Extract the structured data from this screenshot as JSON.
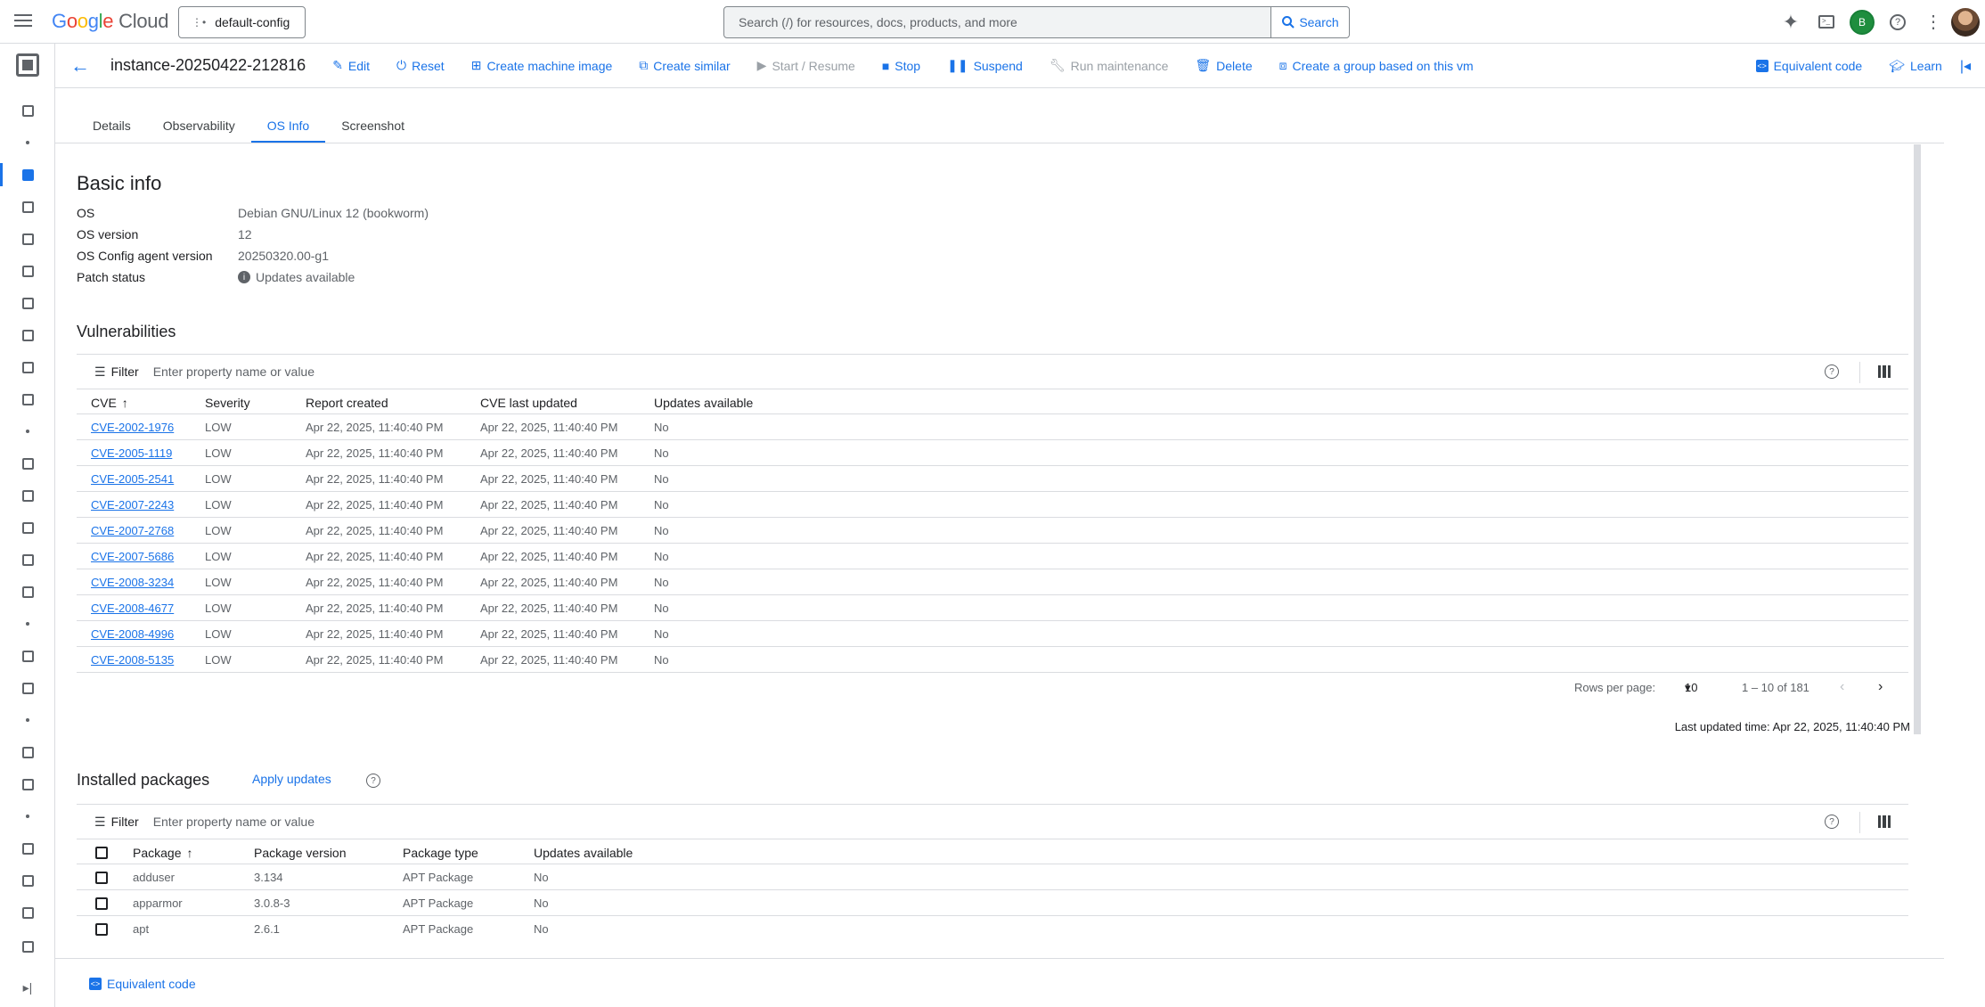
{
  "topbar": {
    "logo_word": "Google",
    "logo_product": "Cloud",
    "project": "default-config",
    "search_placeholder": "Search (/) for resources, docs, products, and more",
    "search_button": "Search",
    "avatar_letter": "B"
  },
  "actionbar": {
    "instance_name": "instance-20250422-212816",
    "actions": {
      "edit": "Edit",
      "reset": "Reset",
      "create_machine_image": "Create machine image",
      "create_similar": "Create similar",
      "start_resume": "Start / Resume",
      "stop": "Stop",
      "suspend": "Suspend",
      "run_maintenance": "Run maintenance",
      "delete": "Delete",
      "create_group": "Create a group based on this vm"
    },
    "equivalent_code": "Equivalent code",
    "learn": "Learn"
  },
  "tabs": {
    "details": "Details",
    "observability": "Observability",
    "os_info": "OS Info",
    "screenshot": "Screenshot"
  },
  "basic_info": {
    "title": "Basic info",
    "os_label": "OS",
    "os_value": "Debian GNU/Linux 12 (bookworm)",
    "os_version_label": "OS version",
    "os_version_value": "12",
    "agent_label": "OS Config agent version",
    "agent_value": "20250320.00-g1",
    "patch_label": "Patch status",
    "patch_value": "Updates available"
  },
  "vulnerabilities": {
    "title": "Vulnerabilities",
    "filter_label": "Filter",
    "filter_placeholder": "Enter property name or value",
    "headers": {
      "cve": "CVE",
      "severity": "Severity",
      "report_created": "Report created",
      "cve_last_updated": "CVE last updated",
      "updates_available": "Updates available"
    },
    "rows": [
      {
        "cve": "CVE-2002-1976",
        "severity": "LOW",
        "created": "Apr 22, 2025, 11:40:40 PM",
        "updated": "Apr 22, 2025, 11:40:40 PM",
        "updates": "No"
      },
      {
        "cve": "CVE-2005-1119",
        "severity": "LOW",
        "created": "Apr 22, 2025, 11:40:40 PM",
        "updated": "Apr 22, 2025, 11:40:40 PM",
        "updates": "No"
      },
      {
        "cve": "CVE-2005-2541",
        "severity": "LOW",
        "created": "Apr 22, 2025, 11:40:40 PM",
        "updated": "Apr 22, 2025, 11:40:40 PM",
        "updates": "No"
      },
      {
        "cve": "CVE-2007-2243",
        "severity": "LOW",
        "created": "Apr 22, 2025, 11:40:40 PM",
        "updated": "Apr 22, 2025, 11:40:40 PM",
        "updates": "No"
      },
      {
        "cve": "CVE-2007-2768",
        "severity": "LOW",
        "created": "Apr 22, 2025, 11:40:40 PM",
        "updated": "Apr 22, 2025, 11:40:40 PM",
        "updates": "No"
      },
      {
        "cve": "CVE-2007-5686",
        "severity": "LOW",
        "created": "Apr 22, 2025, 11:40:40 PM",
        "updated": "Apr 22, 2025, 11:40:40 PM",
        "updates": "No"
      },
      {
        "cve": "CVE-2008-3234",
        "severity": "LOW",
        "created": "Apr 22, 2025, 11:40:40 PM",
        "updated": "Apr 22, 2025, 11:40:40 PM",
        "updates": "No"
      },
      {
        "cve": "CVE-2008-4677",
        "severity": "LOW",
        "created": "Apr 22, 2025, 11:40:40 PM",
        "updated": "Apr 22, 2025, 11:40:40 PM",
        "updates": "No"
      },
      {
        "cve": "CVE-2008-4996",
        "severity": "LOW",
        "created": "Apr 22, 2025, 11:40:40 PM",
        "updated": "Apr 22, 2025, 11:40:40 PM",
        "updates": "No"
      },
      {
        "cve": "CVE-2008-5135",
        "severity": "LOW",
        "created": "Apr 22, 2025, 11:40:40 PM",
        "updated": "Apr 22, 2025, 11:40:40 PM",
        "updates": "No"
      }
    ],
    "rows_per_page_label": "Rows per page:",
    "rows_per_page_value": "10",
    "range": "1 – 10 of 181",
    "last_updated_label": "Last updated time:",
    "last_updated_value": "Apr 22, 2025, 11:40:40 PM"
  },
  "packages": {
    "title": "Installed packages",
    "apply_updates": "Apply updates",
    "filter_label": "Filter",
    "filter_placeholder": "Enter property name or value",
    "headers": {
      "package": "Package",
      "version": "Package version",
      "type": "Package type",
      "updates": "Updates available"
    },
    "rows": [
      {
        "name": "adduser",
        "version": "3.134",
        "type": "APT Package",
        "updates": "No"
      },
      {
        "name": "apparmor",
        "version": "3.0.8-3",
        "type": "APT Package",
        "updates": "No"
      },
      {
        "name": "apt",
        "version": "2.6.1",
        "type": "APT Package",
        "updates": "No"
      }
    ]
  },
  "footer": {
    "equivalent_code": "Equivalent code"
  },
  "colors": {
    "accent": "#1a73e8",
    "border": "#dadce0",
    "text_secondary": "#5f6368",
    "status_ok": "#1e8e3e"
  }
}
